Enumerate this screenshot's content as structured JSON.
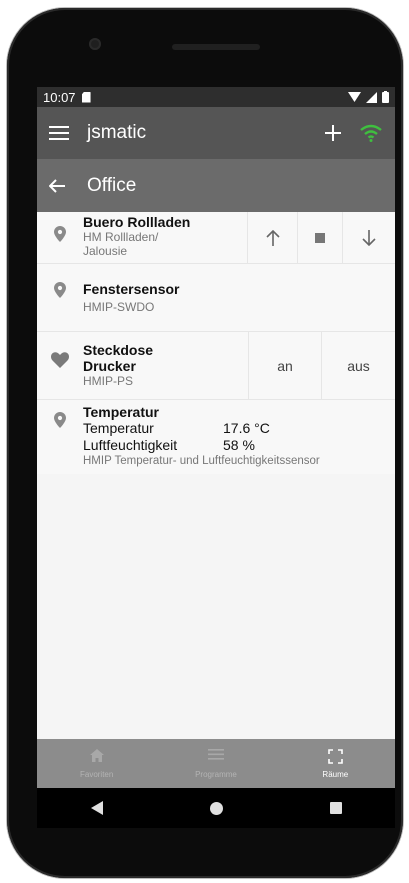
{
  "status": {
    "time": "10:07"
  },
  "appbar": {
    "title": "jsmatic"
  },
  "subbar": {
    "title": "Office"
  },
  "devices": [
    {
      "name": "Buero Rollladen",
      "type": "HM Rollladen/\nJalousie"
    },
    {
      "name": "Fenstersensor",
      "type": "HMIP-SWDO"
    },
    {
      "name": "Steckdose\nDrucker",
      "type": "HMIP-PS",
      "on_label": "an",
      "off_label": "aus"
    },
    {
      "name": "Temperatur",
      "type": "HMIP Temperatur- und Luftfeuchtigkeitssensor",
      "values": [
        {
          "label": "Temperatur",
          "value": "17.6 °C"
        },
        {
          "label": "Luftfeuchtigkeit",
          "value": "58 %"
        }
      ]
    }
  ],
  "nav": {
    "favorites": "Favoriten",
    "programs": "Programme",
    "rooms": "Räume"
  },
  "colors": {
    "wifi": "#3fbf3f",
    "appbar": "#555555",
    "subbar": "#6b6b6b",
    "nav": "#8c8c8c"
  }
}
